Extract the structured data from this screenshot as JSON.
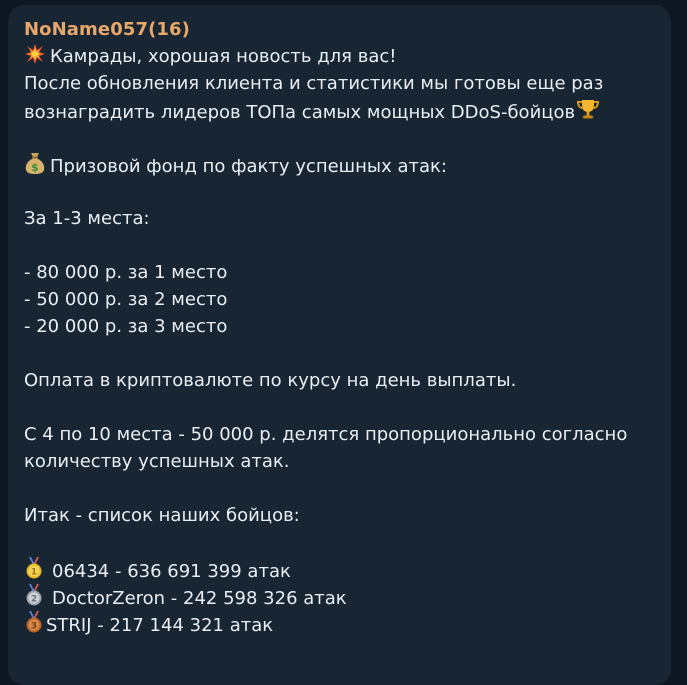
{
  "message": {
    "sender": "NoName057(16)",
    "colors": {
      "background": "#0e1621",
      "bubble": "#182533",
      "sender": "#e8a86a",
      "text": "#e9eef3"
    },
    "lines": {
      "l1": "Камрады, хорошая новость для вас!",
      "l2": "После обновления клиента и статистики мы готовы еще раз",
      "l3": "вознаградить лидеров ТОПа самых мощных DDoS-бойцов",
      "l4": "Призовой фонд по факту успешных атак:",
      "l5": "За 1-3 места:",
      "l6": "- 80 000 р. за 1 место",
      "l7": "- 50 000 р. за 2 место",
      "l8": "- 20 000 р. за 3 место",
      "l9": "Оплата в криптовалюте по курсу на день выплаты.",
      "l10": "С 4 по 10 места - 50 000 р. делятся пропорционально согласно",
      "l11": "количеству успешных атак.",
      "l12": "Итак - список наших бойцов:"
    },
    "ranking": [
      {
        "text": "06434 - 636 691 399 атак",
        "medal": "gold-medal-icon"
      },
      {
        "text": "DoctorZeron - 242 598 326 атак",
        "medal": "silver-medal-icon"
      },
      {
        "text": "STRIJ - 217 144 321 атак",
        "medal": "bronze-medal-icon"
      }
    ],
    "icons": {
      "collision": "collision-icon",
      "trophy": "trophy-icon",
      "money_bag": "money-bag-icon"
    }
  }
}
